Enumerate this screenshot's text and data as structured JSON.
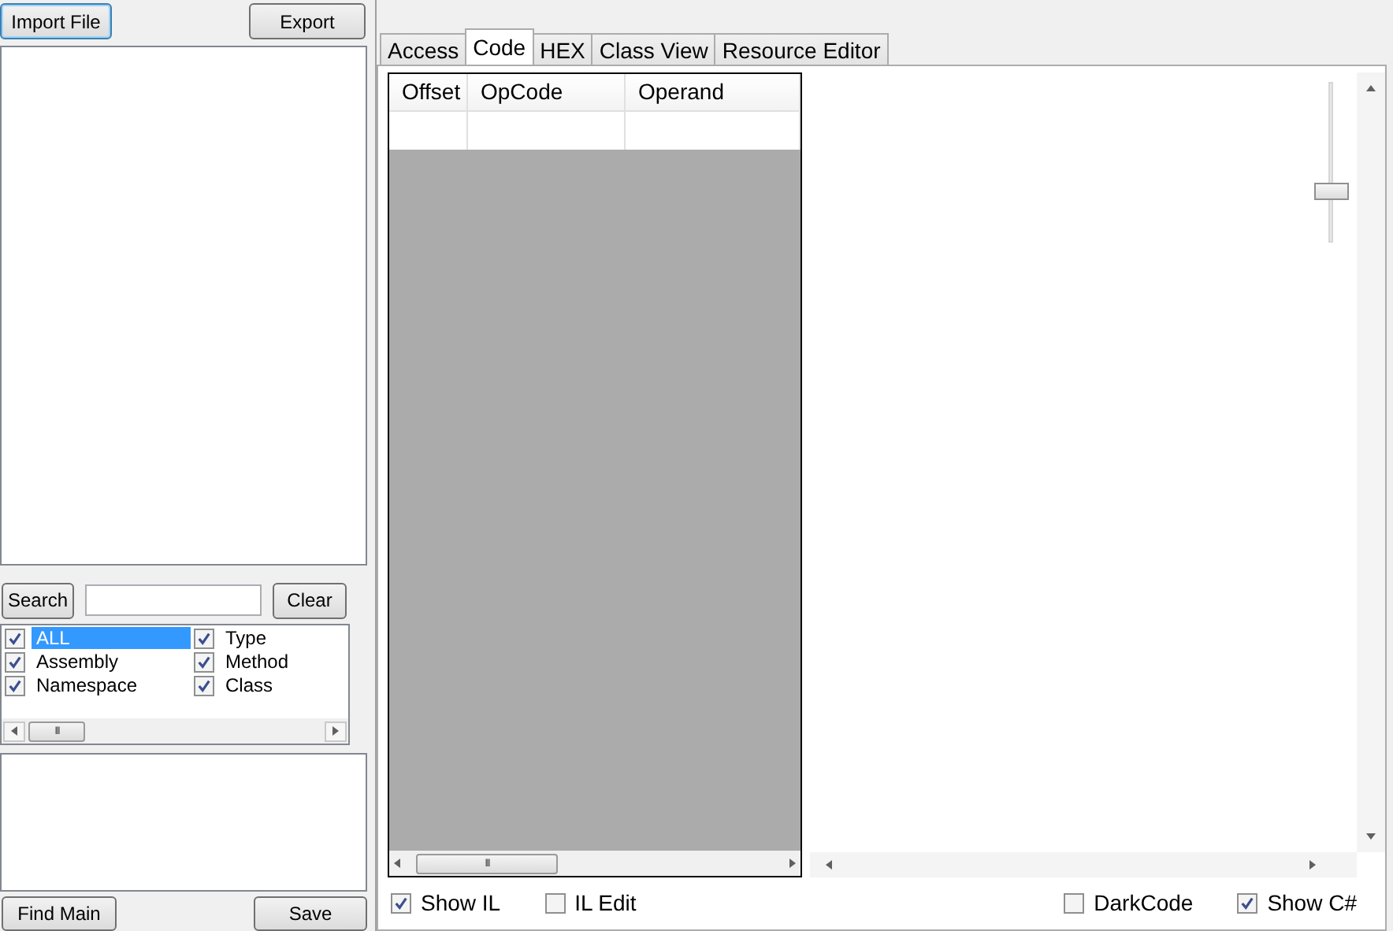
{
  "left_panel": {
    "import_button": "Import File",
    "export_button": "Export",
    "search_button": "Search",
    "clear_button": "Clear",
    "filters": [
      {
        "label": "ALL",
        "checked": true,
        "selected": true
      },
      {
        "label": "Assembly",
        "checked": true,
        "selected": false
      },
      {
        "label": "Namespace",
        "checked": true,
        "selected": false
      },
      {
        "label": "Type",
        "checked": true,
        "selected": false
      },
      {
        "label": "Method",
        "checked": true,
        "selected": false
      },
      {
        "label": "Class",
        "checked": true,
        "selected": false
      }
    ],
    "scroll_grip": "III",
    "find_main_button": "Find Main",
    "save_button": "Save"
  },
  "tabs": [
    {
      "label": "Access",
      "selected": false
    },
    {
      "label": "Code",
      "selected": true
    },
    {
      "label": "HEX",
      "selected": false
    },
    {
      "label": "Class View",
      "selected": false
    },
    {
      "label": "Resource Editor",
      "selected": false
    }
  ],
  "code_grid": {
    "columns": [
      "Offset",
      "OpCode",
      "Operand"
    ],
    "scroll_grip": "III"
  },
  "zoom_slider": {
    "level": 0.3
  },
  "options": [
    {
      "label": "Show IL",
      "checked": true
    },
    {
      "label": "IL Edit",
      "checked": false
    },
    {
      "label": "DarkCode",
      "checked": false
    },
    {
      "label": "Show C#",
      "checked": true
    }
  ]
}
